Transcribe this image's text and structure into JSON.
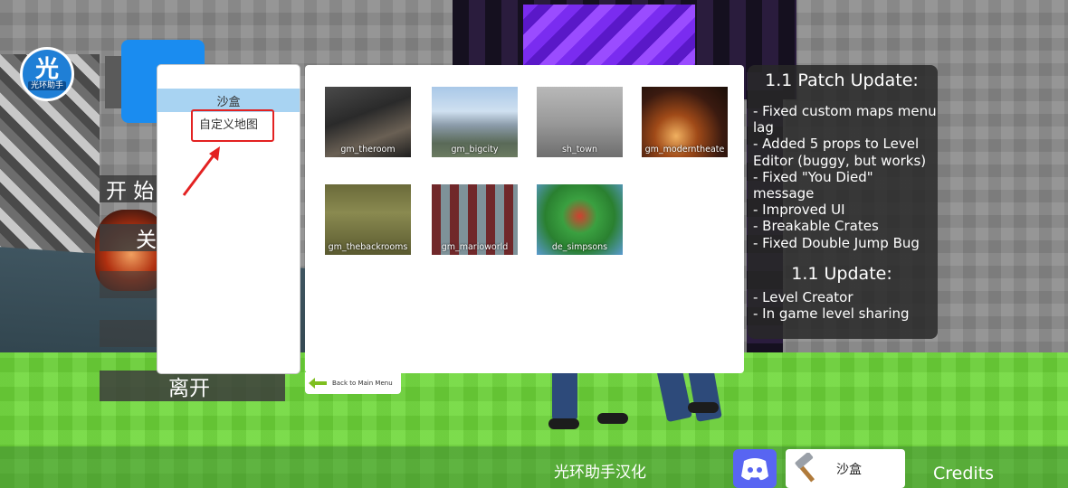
{
  "watermark": {
    "logo_glyph": "光",
    "logo_text": "光环助手"
  },
  "left_menu": {
    "start": "开 始",
    "about": "关",
    "exit": "离开"
  },
  "categories": {
    "selected": "沙盒",
    "custom": "自定义地图"
  },
  "maps": [
    {
      "name": "gm_theroom"
    },
    {
      "name": "gm_bigcity"
    },
    {
      "name": "sh_town"
    },
    {
      "name": "gm_moderntheate"
    },
    {
      "name": "gm_thebackrooms"
    },
    {
      "name": "gm_marioworld"
    },
    {
      "name": "de_simpsons"
    }
  ],
  "back_button": "Back to Main Menu",
  "patch_notes": {
    "title1": "1.1 Patch Update:",
    "items1": [
      "- Fixed custom maps menu lag",
      "- Added 5 props to Level Editor (buggy, but works)",
      "- Fixed \"You Died\" message",
      "- Improved UI",
      "- Breakable Crates",
      "- Fixed Double Jump Bug"
    ],
    "title2": "1.1 Update:",
    "items2": [
      "- Level Creator",
      "- In game level sharing"
    ]
  },
  "bottom": {
    "center_text": "光环助手汉化",
    "sandbox_label": "沙盒",
    "credits": "Credits"
  },
  "colors": {
    "highlight": "#e32222",
    "selected_category": "#a8d3f2",
    "discord": "#5865f2",
    "grass": "#6fd83a"
  },
  "icons": [
    "discord-icon",
    "hammer-icon",
    "back-arrow-icon",
    "red-arrow-annotation"
  ]
}
